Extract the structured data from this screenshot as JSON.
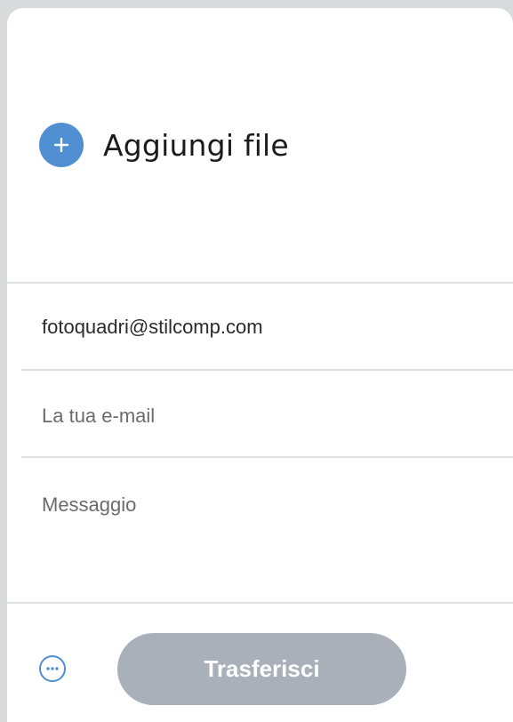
{
  "add_file": {
    "icon": "plus-icon",
    "label": "Aggiungi file",
    "accent_color": "#4f8fd2"
  },
  "form": {
    "recipient_value": "fotoquadri@stilcomp.com",
    "sender_placeholder": "La tua e-mail",
    "message_placeholder": "Messaggio"
  },
  "footer": {
    "more_icon": "more-options-icon",
    "transfer_label": "Trasferisci",
    "transfer_color": "#a9b0b9"
  }
}
